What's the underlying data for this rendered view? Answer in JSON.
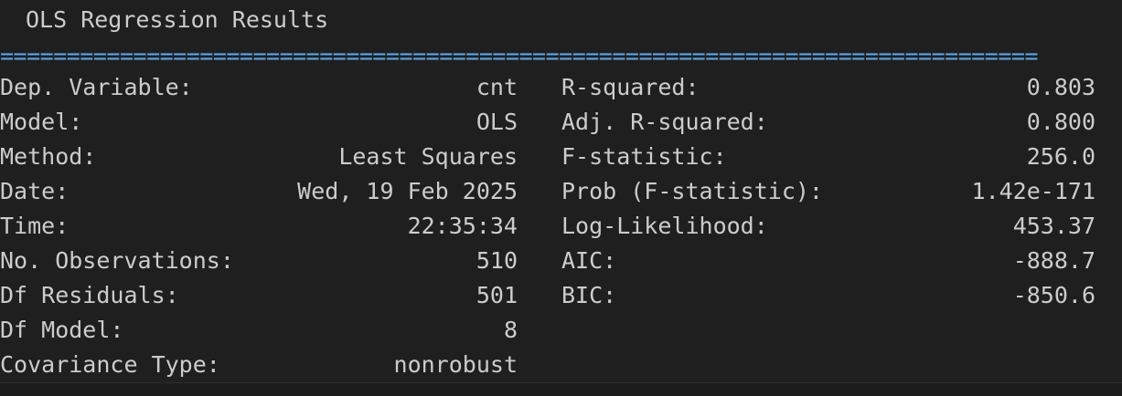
{
  "title": "OLS Regression Results",
  "separator": "==============================================================================",
  "rows": [
    {
      "left_label": "Dep. Variable:",
      "left_value": "cnt",
      "right_label": "R-squared:",
      "right_value": "0.803"
    },
    {
      "left_label": "Model:",
      "left_value": "OLS",
      "right_label": "Adj. R-squared:",
      "right_value": "0.800"
    },
    {
      "left_label": "Method:",
      "left_value": "Least Squares",
      "right_label": "F-statistic:",
      "right_value": "256.0"
    },
    {
      "left_label": "Date:",
      "left_value": "Wed, 19 Feb 2025",
      "right_label": "Prob (F-statistic):",
      "right_value": "1.42e-171"
    },
    {
      "left_label": "Time:",
      "left_value": "22:35:34",
      "right_label": "Log-Likelihood:",
      "right_value": "453.37"
    },
    {
      "left_label": "No. Observations:",
      "left_value": "510",
      "right_label": "AIC:",
      "right_value": "-888.7"
    },
    {
      "left_label": "Df Residuals:",
      "left_value": "501",
      "right_label": "BIC:",
      "right_value": "-850.6"
    },
    {
      "left_label": "Df Model:",
      "left_value": "8",
      "right_label": "",
      "right_value": ""
    },
    {
      "left_label": "Covariance Type:",
      "left_value": "nonrobust",
      "right_label": "",
      "right_value": ""
    }
  ],
  "colors": {
    "background": "#1f1f1f",
    "text": "#cccccc",
    "separator": "#5aa3e6"
  }
}
